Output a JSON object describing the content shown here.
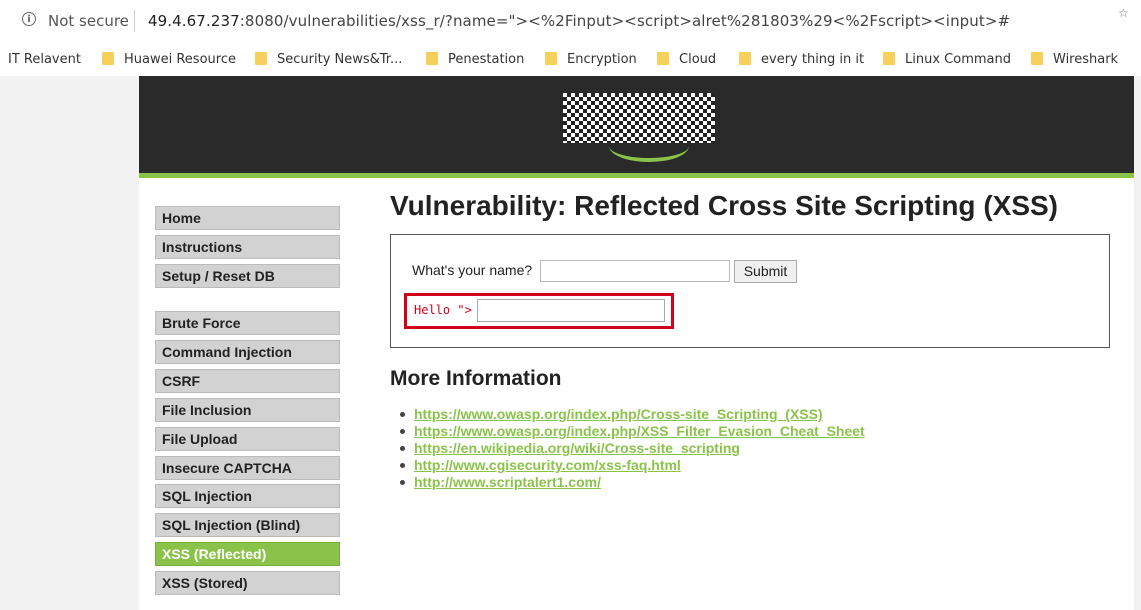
{
  "browser": {
    "security_label": "Not secure",
    "url_host": "49.4.67.237",
    "url_rest": ":8080/vulnerabilities/xss_r/?name=\"><%2Finput><script>alret%281803%29<%2Fscript><input>#"
  },
  "bookmarks": [
    {
      "label": "IT Relavent"
    },
    {
      "label": "Huawei Resource"
    },
    {
      "label": "Security News&Tr..."
    },
    {
      "label": "Penestation"
    },
    {
      "label": "Encryption"
    },
    {
      "label": "Cloud"
    },
    {
      "label": "every thing in it"
    },
    {
      "label": "Linux Command"
    },
    {
      "label": "Wireshark"
    }
  ],
  "menu": {
    "items": [
      {
        "label": "Home"
      },
      {
        "label": "Instructions"
      },
      {
        "label": "Setup / Reset DB"
      },
      {
        "label": "Brute Force"
      },
      {
        "label": "Command Injection"
      },
      {
        "label": "CSRF"
      },
      {
        "label": "File Inclusion"
      },
      {
        "label": "File Upload"
      },
      {
        "label": "Insecure CAPTCHA"
      },
      {
        "label": "SQL Injection"
      },
      {
        "label": "SQL Injection (Blind)"
      },
      {
        "label": "XSS (Reflected)",
        "selected": true
      },
      {
        "label": "XSS (Stored)"
      }
    ]
  },
  "main": {
    "title": "Vulnerability: Reflected Cross Site Scripting (XSS)",
    "form": {
      "name_label": "What's your name?",
      "name_value": "",
      "submit_label": "Submit"
    },
    "output": {
      "hello_text": "Hello \">"
    },
    "more_info_heading": "More Information",
    "links": [
      "https://www.owasp.org/index.php/Cross-site_Scripting_(XSS)",
      "https://www.owasp.org/index.php/XSS_Filter_Evasion_Cheat_Sheet",
      "https://en.wikipedia.org/wiki/Cross-site_scripting",
      "http://www.cgisecurity.com/xss-faq.html",
      "http://www.scriptalert1.com/"
    ]
  },
  "colors": {
    "accent_green": "#8bc34a",
    "highlight_red": "#d0021b",
    "header_dark": "#2a2a2a"
  }
}
